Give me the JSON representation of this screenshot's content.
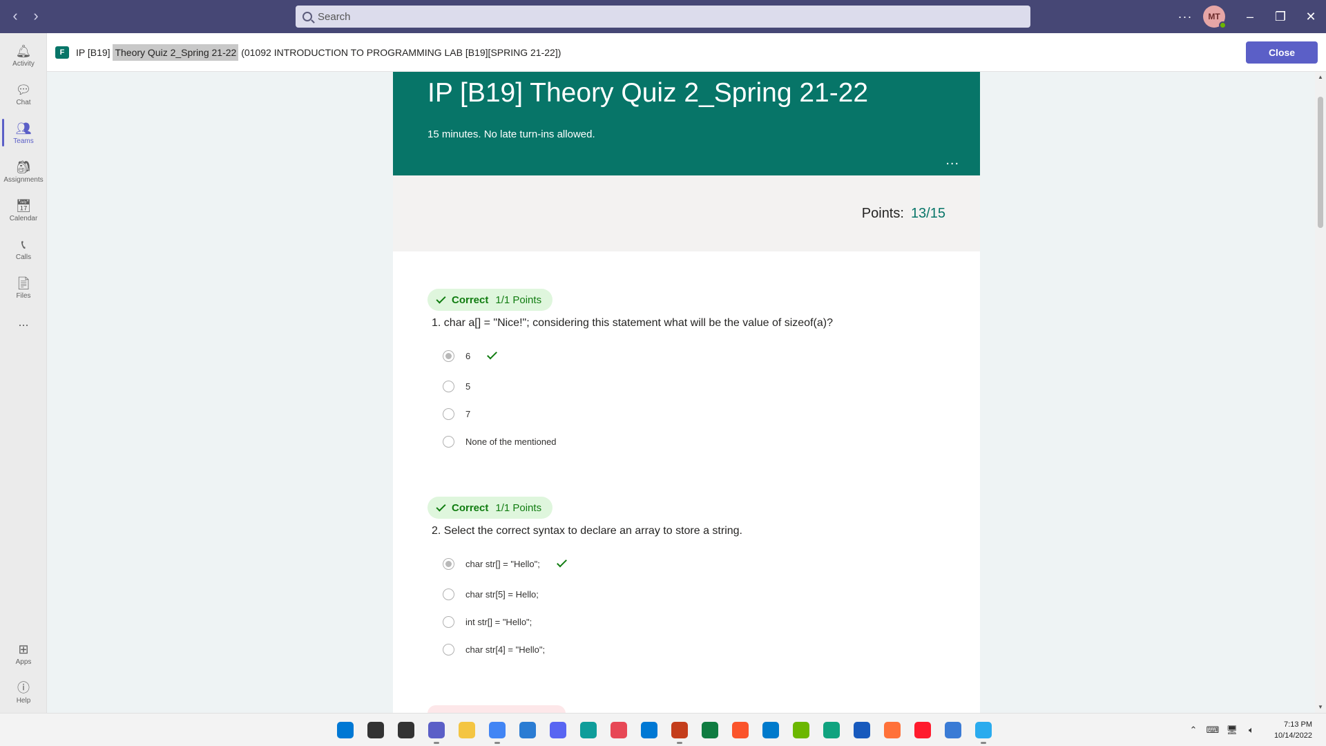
{
  "search": {
    "placeholder": "Search"
  },
  "user": {
    "initials": "MT"
  },
  "rail": {
    "items": [
      {
        "label": "Activity"
      },
      {
        "label": "Chat"
      },
      {
        "label": "Teams"
      },
      {
        "label": "Assignments"
      },
      {
        "label": "Calendar"
      },
      {
        "label": "Calls"
      },
      {
        "label": "Files"
      }
    ],
    "more": "...",
    "apps_label": "Apps",
    "help_label": "Help"
  },
  "header": {
    "prefix": "IP [B19] ",
    "highlight": "Theory Quiz 2_Spring 21-22",
    "suffix": " (01092 INTRODUCTION TO PROGRAMMING LAB [B19][SPRING 21-22])",
    "close_label": "Close"
  },
  "form": {
    "title": "IP [B19] Theory Quiz 2_Spring 21-22",
    "description": "15 minutes. No late turn-ins allowed.",
    "more": "...",
    "points_label": "Points:",
    "points_value": "13/15"
  },
  "questions": [
    {
      "status": "Correct",
      "points": "1/1 Points",
      "text": "1. char a[] = \"Nice!\"; considering this statement what will be the value of sizeof(a)?",
      "options": [
        {
          "label": "6",
          "selected": true,
          "correct": true
        },
        {
          "label": "5",
          "selected": false,
          "correct": false
        },
        {
          "label": "7",
          "selected": false,
          "correct": false
        },
        {
          "label": "None of the mentioned",
          "selected": false,
          "correct": false
        }
      ]
    },
    {
      "status": "Correct",
      "points": "1/1 Points",
      "text": "2. Select the correct syntax to declare an array to store a string.",
      "options": [
        {
          "label": "char str[] = \"Hello\";",
          "selected": true,
          "correct": true
        },
        {
          "label": "char str[5] = Hello;",
          "selected": false,
          "correct": false
        },
        {
          "label": "int str[] = \"Hello\";",
          "selected": false,
          "correct": false
        },
        {
          "label": "char str[4] = \"Hello\";",
          "selected": false,
          "correct": false
        }
      ]
    }
  ],
  "taskbar": {
    "apps": [
      {
        "name": "windows-start",
        "color": "#0078d4"
      },
      {
        "name": "search",
        "color": "#333333"
      },
      {
        "name": "file-viewer",
        "color": "#333333"
      },
      {
        "name": "teams",
        "color": "#5b5fc7"
      },
      {
        "name": "file-explorer",
        "color": "#f4c542"
      },
      {
        "name": "chrome",
        "color": "#4285f4"
      },
      {
        "name": "notepad",
        "color": "#2b7cd3"
      },
      {
        "name": "discord",
        "color": "#5865f2"
      },
      {
        "name": "edge",
        "color": "#0f9d9a"
      },
      {
        "name": "store",
        "color": "#e74856"
      },
      {
        "name": "outlook",
        "color": "#0078d4"
      },
      {
        "name": "powerpoint",
        "color": "#c43e1c"
      },
      {
        "name": "excel",
        "color": "#107c41"
      },
      {
        "name": "brave",
        "color": "#fb542b"
      },
      {
        "name": "vscode",
        "color": "#007acc"
      },
      {
        "name": "notes",
        "color": "#6bb700"
      },
      {
        "name": "chatgpt",
        "color": "#10a37f"
      },
      {
        "name": "word",
        "color": "#185abd"
      },
      {
        "name": "firefox",
        "color": "#ff7139"
      },
      {
        "name": "opera",
        "color": "#ff1b2d"
      },
      {
        "name": "hex-app",
        "color": "#3a7bd5"
      },
      {
        "name": "telegram",
        "color": "#2aabee"
      }
    ],
    "time": "7:13 PM",
    "date": "10/14/2022"
  }
}
